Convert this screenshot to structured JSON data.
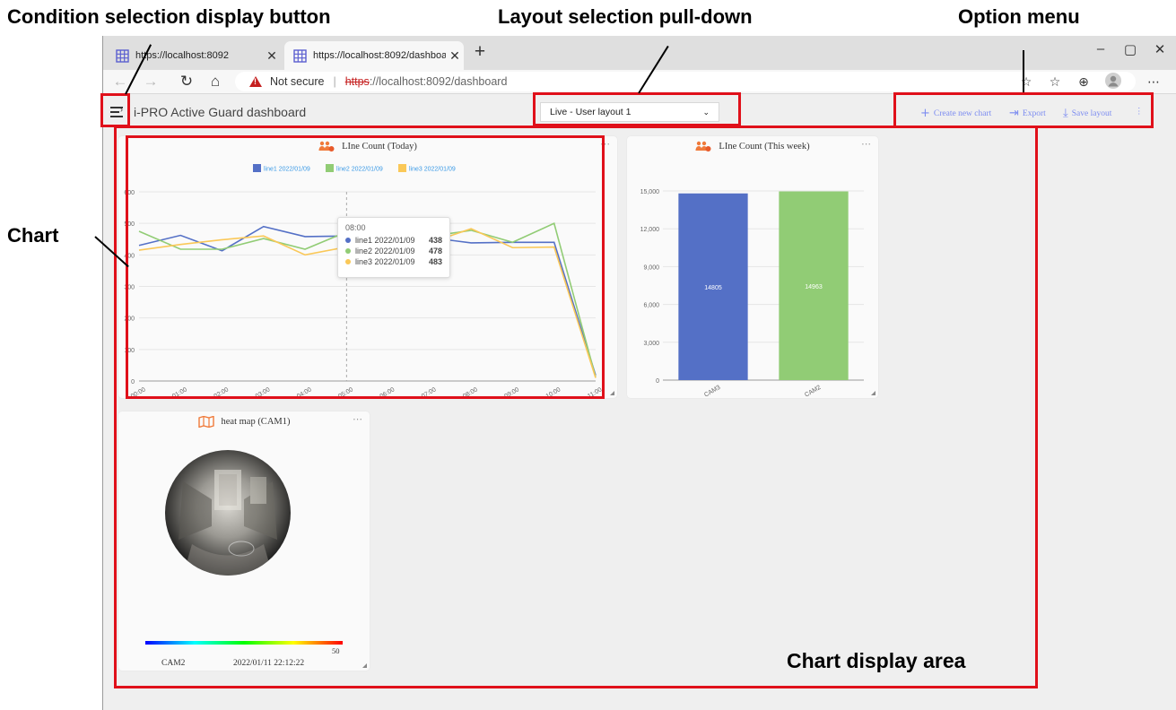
{
  "annotations": {
    "condition_button": "Condition selection display button",
    "layout_pulldown": "Layout selection pull-down",
    "option_menu": "Option menu",
    "chart": "Chart",
    "chart_area": "Chart display area"
  },
  "browser": {
    "tabs": [
      {
        "label": "https://localhost:8092",
        "active": false
      },
      {
        "label": "https://localhost:8092/dashboard",
        "active": true
      }
    ],
    "address": {
      "security": "Not secure",
      "scheme": "https",
      "rest": "://localhost:8092/dashboard"
    }
  },
  "app": {
    "title": "i-PRO Active Guard dashboard",
    "layout_select": "Live - User layout 1",
    "options": {
      "create": "Create new chart",
      "export": "Export",
      "save": "Save layout",
      "more": "⋮"
    }
  },
  "cards": {
    "today": {
      "title": "LIne Count (Today)",
      "tooltip": {
        "time": "08:00",
        "rows": [
          {
            "name": "line1 2022/01/09",
            "value": "438"
          },
          {
            "name": "line2 2022/01/09",
            "value": "478"
          },
          {
            "name": "line3 2022/01/09",
            "value": "483"
          }
        ]
      }
    },
    "week": {
      "title": "LIne Count (This week)"
    },
    "heatmap": {
      "title": "heat map (CAM1)",
      "scale_max": "50",
      "camera": "CAM2",
      "timestamp": "2022/01/11 22:12:22",
      "colors": [
        "#0000ff",
        "#00ffff",
        "#00ff00",
        "#ffff00",
        "#ff0000"
      ]
    }
  },
  "chart_data": [
    {
      "type": "line",
      "title": "LIne Count (Today)",
      "x": [
        "00:00",
        "01:00",
        "02:00",
        "03:00",
        "04:00",
        "05:00",
        "06:00",
        "07:00",
        "08:00",
        "09:00",
        "10:00",
        "11:00"
      ],
      "ylim": [
        0,
        600
      ],
      "yticks": [
        "0",
        "100",
        "200",
        "300",
        "400",
        "500",
        "600"
      ],
      "legend": "top-center",
      "series": [
        {
          "name": "line1 2022/01/09",
          "color": "#5470c6",
          "values": [
            430,
            462,
            413,
            490,
            458,
            460,
            450,
            455,
            438,
            440,
            440,
            18
          ]
        },
        {
          "name": "line2 2022/01/09",
          "color": "#91cc75",
          "values": [
            475,
            418,
            418,
            452,
            418,
            473,
            448,
            458,
            478,
            440,
            500,
            12
          ]
        },
        {
          "name": "line3 2022/01/09",
          "color": "#fac858",
          "values": [
            415,
            433,
            448,
            460,
            400,
            425,
            453,
            438,
            483,
            423,
            425,
            10
          ]
        }
      ]
    },
    {
      "type": "bar",
      "title": "LIne Count (This week)",
      "categories": [
        "CAM3",
        "CAM2"
      ],
      "values": [
        14805,
        14963
      ],
      "labels": [
        "14805",
        "14963"
      ],
      "colors": [
        "#5470c6",
        "#91cc75"
      ],
      "ylim": [
        0,
        15000
      ],
      "yticks": [
        "0",
        "3,000",
        "6,000",
        "9,000",
        "12,000",
        "15,000"
      ]
    }
  ]
}
